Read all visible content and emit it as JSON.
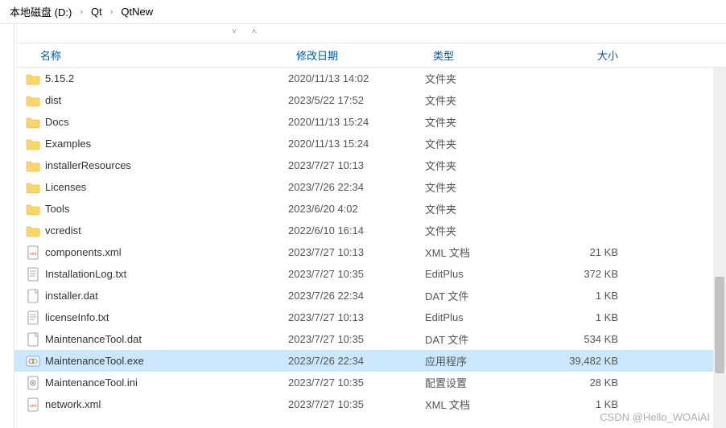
{
  "breadcrumb": {
    "item1": "本地磁盘 (D:)",
    "item2": "Qt",
    "item3": "QtNew"
  },
  "columns": {
    "name": "名称",
    "date": "修改日期",
    "type": "类型",
    "size": "大小"
  },
  "files": [
    {
      "icon": "folder",
      "name": "5.15.2",
      "date": "2020/11/13 14:02",
      "type": "文件夹",
      "size": "",
      "selected": false
    },
    {
      "icon": "folder",
      "name": "dist",
      "date": "2023/5/22 17:52",
      "type": "文件夹",
      "size": "",
      "selected": false
    },
    {
      "icon": "folder",
      "name": "Docs",
      "date": "2020/11/13 15:24",
      "type": "文件夹",
      "size": "",
      "selected": false
    },
    {
      "icon": "folder",
      "name": "Examples",
      "date": "2020/11/13 15:24",
      "type": "文件夹",
      "size": "",
      "selected": false
    },
    {
      "icon": "folder",
      "name": "installerResources",
      "date": "2023/7/27 10:13",
      "type": "文件夹",
      "size": "",
      "selected": false
    },
    {
      "icon": "folder",
      "name": "Licenses",
      "date": "2023/7/26 22:34",
      "type": "文件夹",
      "size": "",
      "selected": false
    },
    {
      "icon": "folder",
      "name": "Tools",
      "date": "2023/6/20 4:02",
      "type": "文件夹",
      "size": "",
      "selected": false
    },
    {
      "icon": "folder",
      "name": "vcredist",
      "date": "2022/6/10 16:14",
      "type": "文件夹",
      "size": "",
      "selected": false
    },
    {
      "icon": "xml",
      "name": "components.xml",
      "date": "2023/7/27 10:13",
      "type": "XML 文档",
      "size": "21 KB",
      "selected": false
    },
    {
      "icon": "txt",
      "name": "InstallationLog.txt",
      "date": "2023/7/27 10:35",
      "type": "EditPlus",
      "size": "372 KB",
      "selected": false
    },
    {
      "icon": "dat",
      "name": "installer.dat",
      "date": "2023/7/26 22:34",
      "type": "DAT 文件",
      "size": "1 KB",
      "selected": false
    },
    {
      "icon": "txt",
      "name": "licenseInfo.txt",
      "date": "2023/7/27 10:13",
      "type": "EditPlus",
      "size": "1 KB",
      "selected": false
    },
    {
      "icon": "dat",
      "name": "MaintenanceTool.dat",
      "date": "2023/7/27 10:35",
      "type": "DAT 文件",
      "size": "534 KB",
      "selected": false
    },
    {
      "icon": "exe",
      "name": "MaintenanceTool.exe",
      "date": "2023/7/26 22:34",
      "type": "应用程序",
      "size": "39,482 KB",
      "selected": true
    },
    {
      "icon": "ini",
      "name": "MaintenanceTool.ini",
      "date": "2023/7/27 10:35",
      "type": "配置设置",
      "size": "28 KB",
      "selected": false
    },
    {
      "icon": "xml",
      "name": "network.xml",
      "date": "2023/7/27 10:35",
      "type": "XML 文档",
      "size": "1 KB",
      "selected": false
    }
  ],
  "watermark": "CSDN @Hello_WOAiAI"
}
